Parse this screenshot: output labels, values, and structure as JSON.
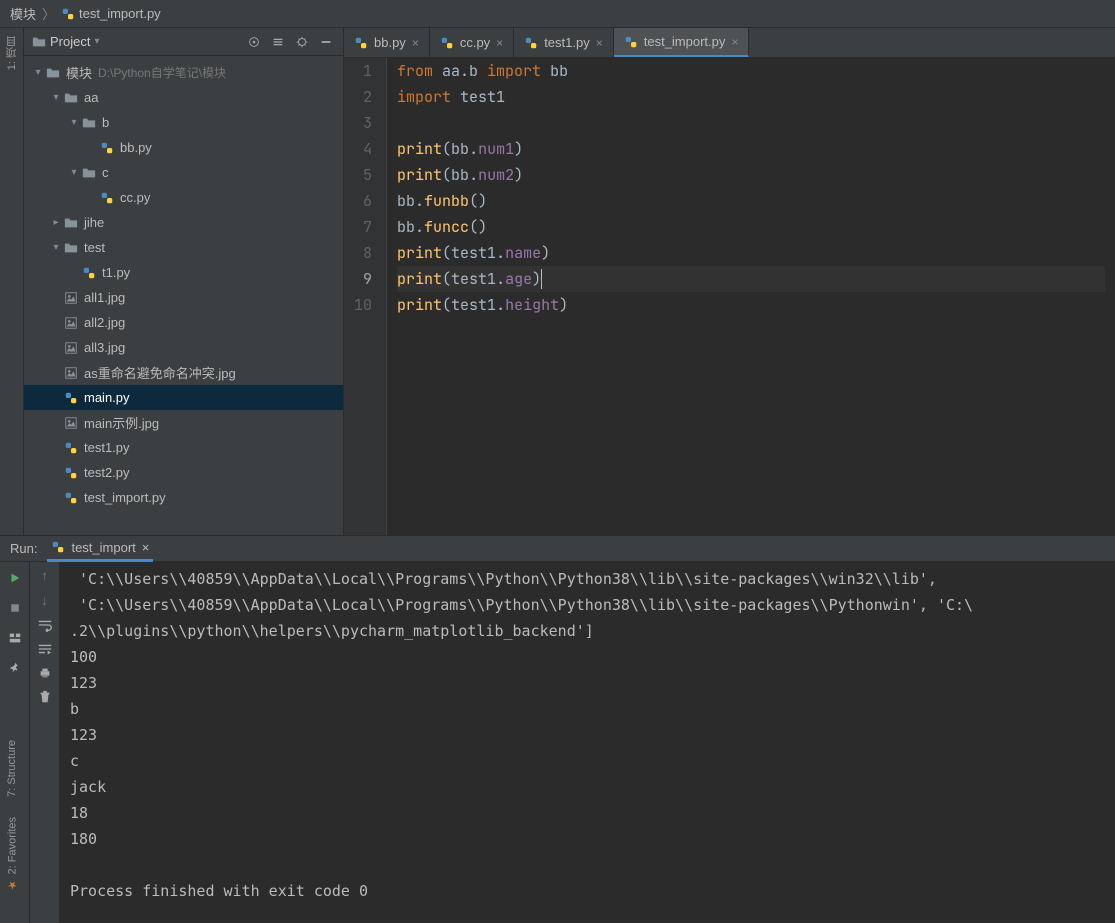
{
  "breadcrumb": {
    "root": "模块",
    "file": "test_import.py"
  },
  "sidebar": {
    "title": "Project",
    "rootLabel": "模块",
    "rootPath": "D:\\Python自学笔记\\模块",
    "nodes": {
      "aa": "aa",
      "b": "b",
      "bb": "bb.py",
      "c": "c",
      "cc": "cc.py",
      "jihe": "jihe",
      "test": "test",
      "t1": "t1.py",
      "all1": "all1.jpg",
      "all2": "all2.jpg",
      "all3": "all3.jpg",
      "asjpg": "as重命名避免命名冲突.jpg",
      "main": "main.py",
      "mainex": "main示例.jpg",
      "test1": "test1.py",
      "test2": "test2.py",
      "ti": "test_import.py"
    }
  },
  "tabs": [
    {
      "label": "bb.py"
    },
    {
      "label": "cc.py"
    },
    {
      "label": "test1.py"
    },
    {
      "label": "test_import.py",
      "active": true
    }
  ],
  "code": {
    "lines": [
      {
        "n": 1,
        "seg": [
          [
            "k",
            "from "
          ],
          [
            "i",
            "aa.b "
          ],
          [
            "k",
            "import "
          ],
          [
            "i",
            "bb"
          ]
        ]
      },
      {
        "n": 2,
        "seg": [
          [
            "k",
            "import "
          ],
          [
            "i",
            "test1"
          ]
        ]
      },
      {
        "n": 3,
        "seg": [
          [
            "",
            ""
          ]
        ]
      },
      {
        "n": 4,
        "seg": [
          [
            "f",
            "print"
          ],
          [
            "p",
            "("
          ],
          [
            "i",
            "bb"
          ],
          [
            "p",
            "."
          ],
          [
            "n",
            "num1"
          ],
          [
            "p",
            ")"
          ]
        ]
      },
      {
        "n": 5,
        "seg": [
          [
            "f",
            "print"
          ],
          [
            "p",
            "("
          ],
          [
            "i",
            "bb"
          ],
          [
            "p",
            "."
          ],
          [
            "n",
            "num2"
          ],
          [
            "p",
            ")"
          ]
        ]
      },
      {
        "n": 6,
        "seg": [
          [
            "i",
            "bb"
          ],
          [
            "p",
            "."
          ],
          [
            "f",
            "funbb"
          ],
          [
            "p",
            "()"
          ]
        ]
      },
      {
        "n": 7,
        "seg": [
          [
            "i",
            "bb"
          ],
          [
            "p",
            "."
          ],
          [
            "f",
            "funcc"
          ],
          [
            "p",
            "()"
          ]
        ]
      },
      {
        "n": 8,
        "seg": [
          [
            "f",
            "print"
          ],
          [
            "p",
            "("
          ],
          [
            "i",
            "test1"
          ],
          [
            "p",
            "."
          ],
          [
            "n",
            "name"
          ],
          [
            "p",
            ")"
          ]
        ]
      },
      {
        "n": 9,
        "seg": [
          [
            "f",
            "print"
          ],
          [
            "p",
            "("
          ],
          [
            "i",
            "test1"
          ],
          [
            "p",
            "."
          ],
          [
            "n",
            "age"
          ],
          [
            "p",
            ")"
          ]
        ],
        "cur": true
      },
      {
        "n": 10,
        "seg": [
          [
            "f",
            "print"
          ],
          [
            "p",
            "("
          ],
          [
            "i",
            "test1"
          ],
          [
            "p",
            "."
          ],
          [
            "n",
            "height"
          ],
          [
            "p",
            ")"
          ]
        ]
      }
    ]
  },
  "run": {
    "label": "Run:",
    "tab": "test_import",
    "output": [
      " 'C:\\\\Users\\\\40859\\\\AppData\\\\Local\\\\Programs\\\\Python\\\\Python38\\\\lib\\\\site-packages\\\\win32\\\\lib',",
      " 'C:\\\\Users\\\\40859\\\\AppData\\\\Local\\\\Programs\\\\Python\\\\Python38\\\\lib\\\\site-packages\\\\Pythonwin', 'C:\\",
      ".2\\\\plugins\\\\python\\\\helpers\\\\pycharm_matplotlib_backend']",
      "100",
      "123",
      "b",
      "123",
      "c",
      "jack",
      "18",
      "180",
      "",
      "Process finished with exit code 0"
    ]
  },
  "rails": {
    "project": "1: 项目",
    "structure": "7: Structure",
    "favorites": "2: Favorites"
  }
}
